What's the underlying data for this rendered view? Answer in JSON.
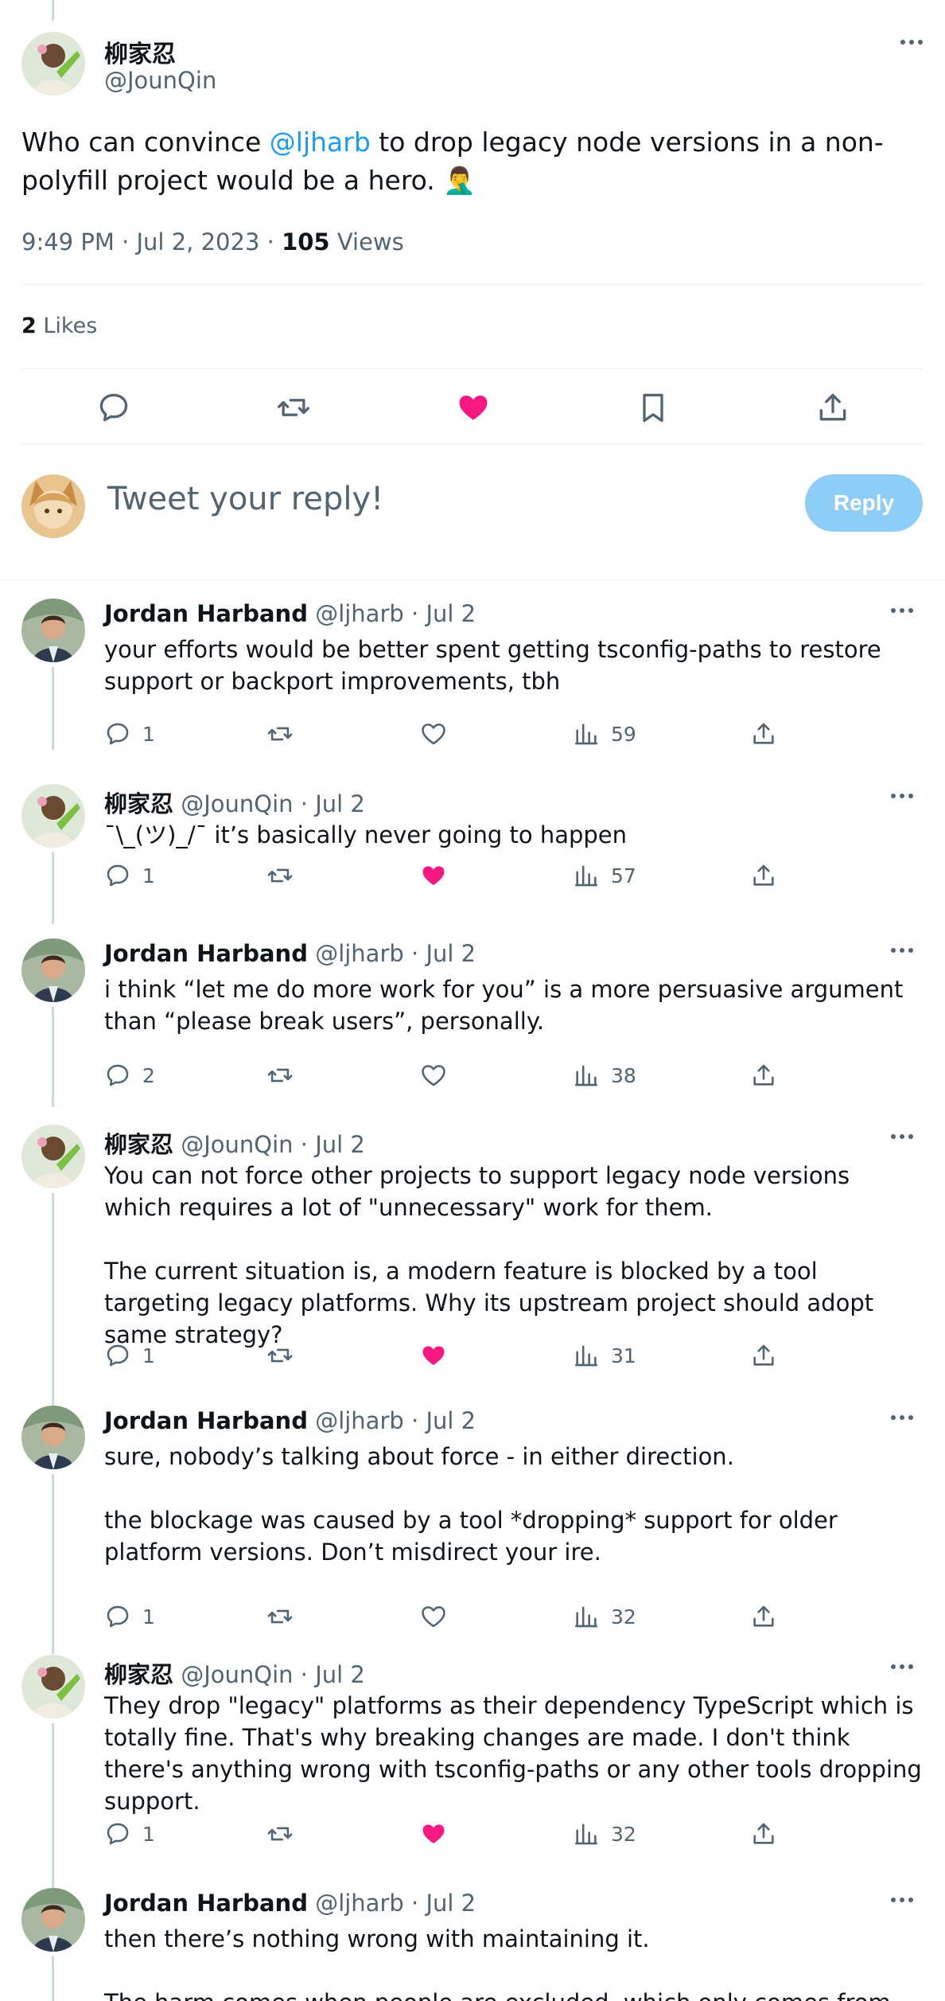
{
  "main_tweet": {
    "name": "柳家忍",
    "handle": "@JounQin",
    "text_before": "Who can convince ",
    "mention": "@ljharb",
    "text_after": " to drop legacy node versions in a non-polyfill project would be a hero. 🤦‍♂️",
    "time": "9:49 PM · Jul 2, 2023 · ",
    "views_count": "105",
    "views_label": " Views",
    "likes_count": "2",
    "likes_label": " Likes",
    "liked": true
  },
  "reply_box": {
    "placeholder": "Tweet your reply!",
    "button": "Reply"
  },
  "replies": [
    {
      "name": "Jordan Harband",
      "meta": "@ljharb · Jul 2",
      "paragraphs": [
        "your efforts would be better spent getting tsconfig-paths to restore support or backport improvements, tbh"
      ],
      "replies": "1",
      "liked": false,
      "views": "59"
    },
    {
      "name": "柳家忍",
      "meta": "@JounQin · Jul 2",
      "paragraphs": [
        "¯\\_(ツ)_/¯ it’s basically never going to happen"
      ],
      "replies": "1",
      "liked": true,
      "views": "57"
    },
    {
      "name": "Jordan Harband",
      "meta": "@ljharb · Jul 2",
      "paragraphs": [
        "i think “let me do more work for you” is a more persuasive argument than “please break users”, personally."
      ],
      "replies": "2",
      "liked": false,
      "views": "38"
    },
    {
      "name": "柳家忍",
      "meta": "@JounQin · Jul 2",
      "paragraphs": [
        "You can not force other projects to support legacy node versions which requires a lot of \"unnecessary\" work for them.",
        "The current situation is, a modern feature is blocked by a tool targeting legacy platforms. Why its upstream project should adopt same strategy?"
      ],
      "replies": "1",
      "liked": true,
      "views": "31"
    },
    {
      "name": "Jordan Harband",
      "meta": "@ljharb · Jul 2",
      "paragraphs": [
        "sure, nobody’s talking about force - in either direction.",
        "the blockage was caused by a tool *dropping* support for older platform versions. Don’t misdirect your ire."
      ],
      "replies": "1",
      "liked": false,
      "views": "32"
    },
    {
      "name": "柳家忍",
      "meta": "@JounQin · Jul 2",
      "paragraphs": [
        "They drop \"legacy\" platforms as their dependency TypeScript which is totally fine. That's why breaking changes are made. I don't think there's anything wrong with tsconfig-paths or any other tools dropping support."
      ],
      "replies": "1",
      "liked": true,
      "views": "32"
    },
    {
      "name": "Jordan Harband",
      "meta": "@ljharb · Jul 2",
      "paragraphs": [
        "then there’s nothing wrong with maintaining it.",
        "The harm comes when people are excluded, which only comes from"
      ],
      "replies": "",
      "liked": false,
      "views": ""
    }
  ],
  "colors": {
    "accent": "#1d9bf0",
    "like": "#f91880",
    "muted": "#536471",
    "reply_button": "#8ecdf8"
  }
}
